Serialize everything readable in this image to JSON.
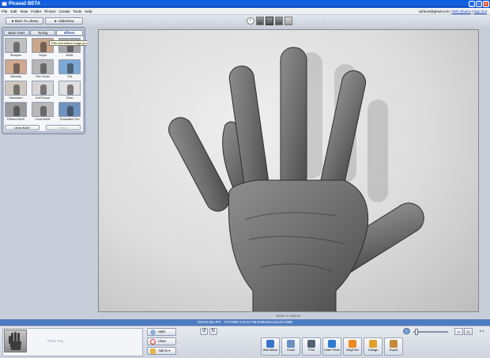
{
  "window": {
    "title": "Picasa2 BETA",
    "buttons": [
      "_",
      "□",
      "x"
    ]
  },
  "menu": [
    "File",
    "Edit",
    "View",
    "Folder",
    "Picture",
    "Create",
    "Tools",
    "Help"
  ],
  "account": {
    "email": "ad.leon@gmail.com",
    "separator": "|",
    "web_albums": "Web Albums",
    "sign_out": "Sign Out"
  },
  "nav": {
    "back_label": "Back To Library",
    "slideshow_label": "Slideshow"
  },
  "tabs": [
    "Basic Fixes",
    "Tuning",
    "Effects"
  ],
  "active_tab": "Effects",
  "effects": [
    {
      "label": "Sharpen",
      "tint": "#bfbfbf"
    },
    {
      "label": "Sepia",
      "tint": "#c9a78b"
    },
    {
      "label": "B&W",
      "tint": "#a6a6a6"
    },
    {
      "label": "Warmify",
      "tint": "#d0a78f"
    },
    {
      "label": "Film Grain",
      "tint": "#b5b5b5"
    },
    {
      "label": "Tint",
      "tint": "#7da9d6"
    },
    {
      "label": "Saturation",
      "tint": "#cfc7be"
    },
    {
      "label": "Soft Focus",
      "tint": "#d5d5d5"
    },
    {
      "label": "Glow",
      "tint": "#e0e0e0"
    },
    {
      "label": "Filtered B&W",
      "tint": "#9a9a9a"
    },
    {
      "label": "Focal B&W",
      "tint": "#b8b8b8"
    },
    {
      "label": "Graduated Tint",
      "tint": "#6f93c0"
    }
  ],
  "tooltip": "Pick and select Image processing",
  "panel_buttons": {
    "undo": "Undo B&W",
    "redo": "Redo"
  },
  "caption_placeholder": "Make a caption!",
  "status": {
    "filename": "DSC04435.JPG",
    "date": "7/27/2006 3:15:22 PM",
    "dimensions": "2048x1944 pixels",
    "size": "2.5MB"
  },
  "tray": {
    "label": "Photo Tray",
    "hold": "Hold",
    "clear": "Clear",
    "add_to": "Add to"
  },
  "rotate": {
    "left": "↺",
    "right": "↻"
  },
  "actions": [
    {
      "label": "Web Album",
      "color": "#3a74c9"
    },
    {
      "label": "Email",
      "color": "#6b90c2"
    },
    {
      "label": "Print",
      "color": "#55606e"
    },
    {
      "label": "Order Prints",
      "color": "#2e7bd0"
    },
    {
      "label": "BlogThis!",
      "color": "#f08a1e"
    },
    {
      "label": "Collage",
      "color": "#e0a12a"
    },
    {
      "label": "Export",
      "color": "#c48a3a"
    }
  ],
  "zoom_level": 0.08,
  "icons": {
    "prev": "arrow-left-icon",
    "next": "arrow-right-icon",
    "rotate_left": "rotate-left-icon",
    "rotate_right": "rotate-right-icon",
    "zoom": "zoom-icon"
  }
}
